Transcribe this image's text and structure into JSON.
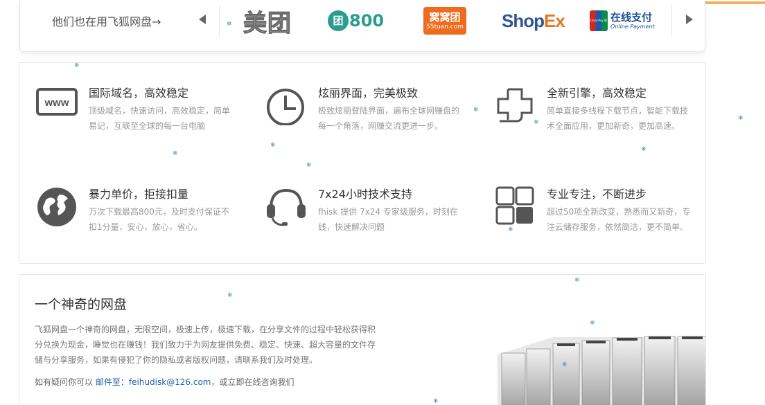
{
  "partners": {
    "label": "他们也在用飞狐网盘→",
    "logos": {
      "meituan": "美团",
      "tuan800_mark": "团",
      "tuan800_num": "800",
      "wowo_cn": "窝窝团",
      "wowo_en": "55tuan.com",
      "shopex_shop": "Shop",
      "shopex_ex": "Ex",
      "unionpay_mark": "UnionPay 银联",
      "unionpay_cn": "在线支付",
      "unionpay_en": "Online Payment"
    }
  },
  "features": [
    {
      "title": "国际域名，高效稳定",
      "desc": "顶级域名，快速访问，高效稳定，简单易记，互联至全球的每一台电脑",
      "icon": "www-icon",
      "icon_text": "www"
    },
    {
      "title": "炫丽界面，完美极致",
      "desc": "极致炫丽登陆界面，遍布全球网赚盘的每一个角落，网赚交流更进一步。",
      "icon": "clock-icon"
    },
    {
      "title": "全新引擎，高效稳定",
      "desc": "简单直接多线程下载节点，智能下载技术全面应用，更加新奇，更加高速。",
      "icon": "engine-icon"
    },
    {
      "title": "暴力单价，拒接扣量",
      "desc": "万次下载最高800元，及时支付保证不扣1分量，安心，放心，省心。",
      "icon": "globe-icon"
    },
    {
      "title": "7x24小时技术支持",
      "desc": "fhisk 提供 7x24 专家级服务，时刻在线，快速解决问题",
      "icon": "headset-icon"
    },
    {
      "title": "专业专注，不断进步",
      "desc": "超过50项全新改变，熟悉而又新奇，专注云储存服务，依然简洁，更不简单。",
      "icon": "grid-icon"
    }
  ],
  "about": {
    "title": "一个神奇的网盘",
    "desc": "飞狐网盘一个神奇的网盘，无限空间，极速上传，极速下载，在分享文件的过程中轻松获得积分兑换为现金，睡觉也在赚钱！我们致力于为网友提供免费、稳定、快速、超大容量的文件存储与分享服务，如果有侵犯了你的隐私或者版权问题，请联系我们及时处理。",
    "contact_prefix": "如有疑问你可以 ",
    "contact_link": "邮件至：",
    "contact_email": "feihudisk@126.com",
    "contact_suffix": "，或立即在线咨询我们"
  },
  "colors": {
    "accent": "#f3b15a",
    "link": "#1f5fa8",
    "icon": "#555555"
  }
}
